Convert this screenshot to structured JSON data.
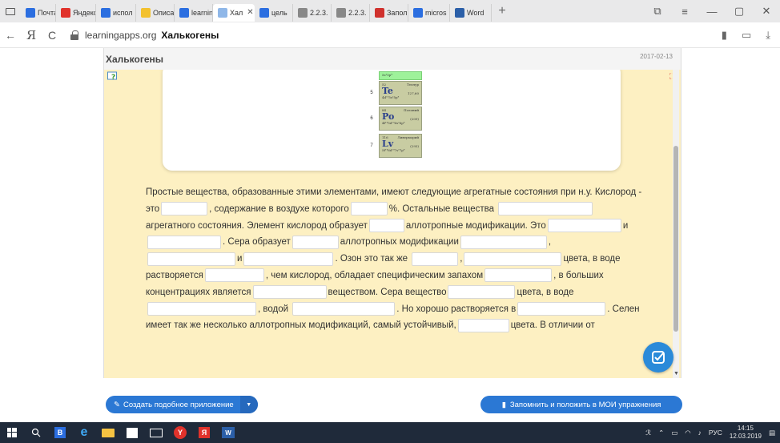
{
  "browser": {
    "tabs": [
      {
        "label": "Почта",
        "icon": "mail-icon",
        "color": "#2b6ee0"
      },
      {
        "label": "Яндекс",
        "icon": "yandex-icon",
        "color": "#e0322b"
      },
      {
        "label": "испол",
        "icon": "search-tab-icon",
        "color": "#2b6ee0"
      },
      {
        "label": "Описа",
        "icon": "doc-tab-icon",
        "color": "#f3c12e"
      },
      {
        "label": "learnin",
        "icon": "search-tab-icon",
        "color": "#2b6ee0"
      },
      {
        "label": "Хал",
        "icon": "learningapps-icon",
        "color": "#8fb7e8",
        "active": true
      },
      {
        "label": "цель",
        "icon": "search-tab-icon",
        "color": "#2b6ee0"
      },
      {
        "label": "2.2.3.",
        "icon": "page-icon",
        "color": "#888888"
      },
      {
        "label": "2.2.3.",
        "icon": "page-icon",
        "color": "#888888"
      },
      {
        "label": "Запол",
        "icon": "l-logo-icon",
        "color": "#d0312d"
      },
      {
        "label": "micros",
        "icon": "search-tab-icon",
        "color": "#2b6ee0"
      },
      {
        "label": "Word",
        "icon": "word-icon",
        "color": "#2b5fa8"
      }
    ],
    "new_tab": "+",
    "window_controls": {
      "minimize": "—",
      "maximize": "▢",
      "close": "✕"
    },
    "address": {
      "back": "←",
      "yandex": "Я",
      "reload": "C",
      "domain": "learningapps.org",
      "page_title": "Халькогены"
    }
  },
  "app": {
    "title": "Халькогены",
    "date": "2017-02-13",
    "table_rows": [
      {
        "period": "",
        "cells": [
          {
            "config": "5s²5p⁴",
            "green": true
          }
        ]
      },
      {
        "period": "5",
        "cells": [
          {
            "number": "52",
            "name": "Теллур",
            "symbol": "Te",
            "mass": "127,60",
            "config": "4d¹⁰5s²5p⁴"
          }
        ]
      },
      {
        "period": "6",
        "cells": [
          {
            "number": "84",
            "name": "Полоний",
            "symbol": "Po",
            "mass": "(209)",
            "config": "4f¹⁴5d¹⁰6s²6p⁴"
          }
        ]
      },
      {
        "period": "7",
        "cells": [
          {
            "number": "116",
            "name": "Ливерморий",
            "symbol": "Lv",
            "mass": "(293)",
            "config": "5f¹⁴6d¹⁰7s²7p⁴"
          }
        ]
      }
    ],
    "text": {
      "t1": "Простые вещества, образованные этими элементами, имеют следующие агрегатные состояния при н.у. Кислород - это",
      "t2": ", содержание в воздухе которого",
      "t3": "%. Остальные вещества",
      "t4": "агрегатного состояния. Элемент кислород образует",
      "t5": "аллотропные модификации. Это",
      "t6": "и",
      "t7": ". Сера образует",
      "t8": "аллотропных модификации",
      "t9": ",",
      "t10": "и",
      "t11": ". Озон это так же",
      "t12": ",",
      "t13": "цвета, в воде растворяется",
      "t14": ", чем кислород, обладает специфическим запахом",
      "t15": ", в больших концентрациях является",
      "t16": "веществом. Сера вещество",
      "t17": "цвета, в воде",
      "t18": ", водой",
      "t19": ". Но хорошо растворяется в",
      "t20": ". Селен имеет так же несколько аллотропных модификаций, самый устойчивый,",
      "t21": "цвета. В отличии от"
    },
    "create_button": "Создать подобное приложение",
    "save_button": "Запомнить и положить в МОИ упражнения"
  },
  "taskbar": {
    "tray": {
      "lang": "РУС",
      "time": "14:15",
      "date": "12.03.2019"
    }
  },
  "colors": {
    "app_bg": "#fdf0c2",
    "button_blue": "#2b78d4",
    "taskbar": "#1f2a3a"
  }
}
